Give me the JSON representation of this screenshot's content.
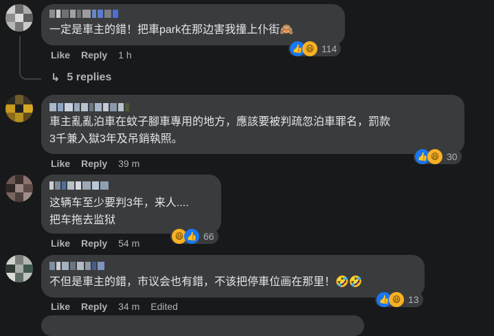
{
  "comments": [
    {
      "text_lines": [
        "一定是車主的錯！把車park在那边害我撞上仆街🙈"
      ],
      "like": "Like",
      "reply": "Reply",
      "time": "1 h",
      "reaction_count": "114",
      "reaction_icons": [
        "like-icon",
        "haha-icon"
      ]
    },
    {
      "text_lines": [
        "車主亂亂泊車在蚊子腳車專用的地方，應該要被判疏忽泊車罪名，罰款",
        "3千兼入獄3年及吊銷執照。"
      ],
      "like": "Like",
      "reply": "Reply",
      "time": "39 m",
      "reaction_count": "30",
      "reaction_icons": [
        "like-icon",
        "haha-icon"
      ]
    },
    {
      "text_lines": [
        "这辆车至少要判3年，来人....",
        "把车拖去监狱"
      ],
      "like": "Like",
      "reply": "Reply",
      "time": "54 m",
      "reaction_count": "66",
      "reaction_icons": [
        "haha-icon",
        "like-icon"
      ]
    },
    {
      "text_lines": [
        "不但是車主的錯，市议会也有錯，不该把停車位画在那里！🤣🤣"
      ],
      "like": "Like",
      "reply": "Reply",
      "time": "34 m",
      "edited": "Edited",
      "reaction_count": "13",
      "reaction_icons": [
        "like-icon",
        "haha-icon"
      ]
    }
  ],
  "replies_link": "5 replies",
  "colors": {
    "background": "#18191a",
    "bubble": "#3a3b3c",
    "text": "#e4e6eb",
    "secondary": "#b0b3b8",
    "like_blue": "#1877f2",
    "haha_yellow": "#f7b125"
  }
}
